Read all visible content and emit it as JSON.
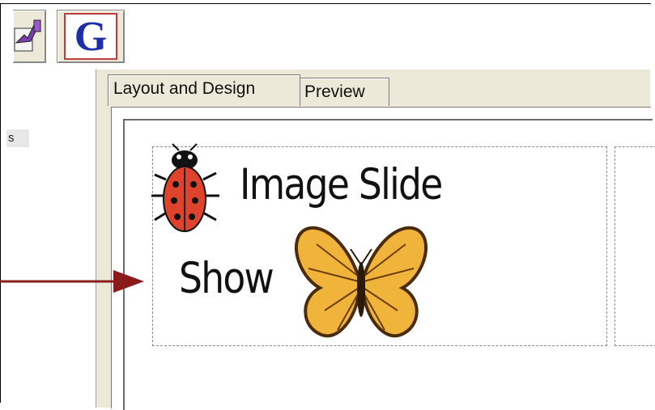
{
  "toolbar": {
    "left_button_icon": "hand-pointer-icon",
    "g_button_label": "G",
    "g_button_icon": "g-letter-icon"
  },
  "left_panel": {
    "item_label": "s"
  },
  "tabs": [
    {
      "label": "Layout and Design",
      "active": true
    },
    {
      "label": "Preview",
      "active": false
    }
  ],
  "slide": {
    "title_line1": "Image Slide",
    "title_line2": "Show",
    "images": [
      "ladybug-icon",
      "butterfly-icon"
    ]
  },
  "colors": {
    "arrow": "#8b1a1a",
    "g_letter": "#1d2fa8",
    "g_border": "#c23b3b",
    "panel_bg": "#ece9d8"
  }
}
